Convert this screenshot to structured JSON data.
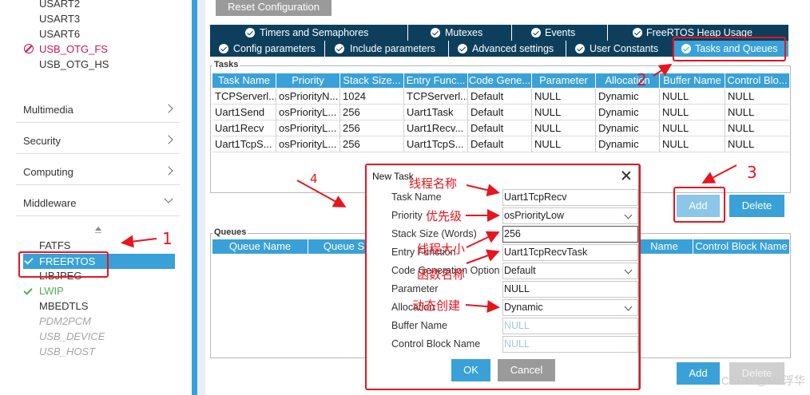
{
  "sidebar": {
    "peripherals": [
      {
        "label": "USART2",
        "status": "normal"
      },
      {
        "label": "USART3",
        "status": "normal"
      },
      {
        "label": "USART6",
        "status": "normal"
      },
      {
        "label": "USB_OTG_FS",
        "status": "error"
      },
      {
        "label": "USB_OTG_HS",
        "status": "normal"
      }
    ],
    "categories": [
      {
        "label": "Multimedia",
        "icon": "chevron-right-icon"
      },
      {
        "label": "Security",
        "icon": "chevron-right-icon"
      },
      {
        "label": "Computing",
        "icon": "chevron-right-icon"
      },
      {
        "label": "Middleware",
        "icon": "chevron-down-icon"
      }
    ],
    "middleware": [
      {
        "label": "FATFS",
        "status": "normal"
      },
      {
        "label": "FREERTOS",
        "status": "selected"
      },
      {
        "label": "LIBJPEG",
        "status": "normal"
      },
      {
        "label": "LWIP",
        "status": "enabled"
      },
      {
        "label": "MBEDTLS",
        "status": "normal"
      },
      {
        "label": "PDM2PCM",
        "status": "disabled"
      },
      {
        "label": "USB_DEVICE",
        "status": "disabled"
      },
      {
        "label": "USB_HOST",
        "status": "disabled"
      }
    ]
  },
  "main": {
    "reset_label": "Reset Configuration",
    "tabs_row1": [
      "Timers and Semaphores",
      "Mutexes",
      "Events",
      "FreeRTOS Heap Usage"
    ],
    "tabs_row2": [
      "Config parameters",
      "Include parameters",
      "Advanced settings",
      "User Constants",
      "Tasks and Queues"
    ],
    "active_tab": "Tasks and Queues",
    "tasks": {
      "title": "Tasks",
      "columns": [
        "Task Name",
        "Priority",
        "Stack Size...",
        "Entry Func...",
        "Code Gene...",
        "Parameter",
        "Allocation",
        "Buffer Name",
        "Control Blo..."
      ],
      "rows": [
        [
          "TCPServerl...",
          "osPriorityN...",
          "1024",
          "TCPServerl...",
          "Default",
          "NULL",
          "Dynamic",
          "NULL",
          "NULL"
        ],
        [
          "Uart1Send",
          "osPriorityL...",
          "256",
          "Uart1Task",
          "Default",
          "NULL",
          "Dynamic",
          "NULL",
          "NULL"
        ],
        [
          "Uart1Recv",
          "osPriorityL...",
          "256",
          "Uart1Recv...",
          "Default",
          "NULL",
          "Dynamic",
          "NULL",
          "NULL"
        ],
        [
          "Uart1TcpS...",
          "osPriorityL...",
          "256",
          "Uart1TcpS...",
          "Default",
          "NULL",
          "Dynamic",
          "NULL",
          "NULL"
        ]
      ],
      "add_label": "Add",
      "delete_label": "Delete"
    },
    "queues": {
      "title": "Queues",
      "columns_left": [
        "Queue Name",
        "Queue S"
      ],
      "columns_right": [
        "Name",
        "Control Block Name"
      ],
      "add_label": "Add",
      "delete_label": "Delete"
    }
  },
  "dialog": {
    "title": "New Task",
    "fields": [
      {
        "label": "Task Name",
        "value": "Uart1TcpRecv",
        "kind": "text"
      },
      {
        "label": "Priority",
        "value": "osPriorityLow",
        "kind": "select"
      },
      {
        "label": "Stack Size (Words)",
        "value": "256",
        "kind": "text-focus"
      },
      {
        "label": "Entry Function",
        "value": "Uart1TcpRecvTask",
        "kind": "text"
      },
      {
        "label": "Code Generation Option",
        "value": "Default",
        "kind": "select"
      },
      {
        "label": "Parameter",
        "value": "NULL",
        "kind": "text"
      },
      {
        "label": "Allocation",
        "value": "Dynamic",
        "kind": "select"
      },
      {
        "label": "Buffer Name",
        "value": "NULL",
        "kind": "text-empty"
      },
      {
        "label": "Control Block Name",
        "value": "NULL",
        "kind": "text-empty"
      }
    ],
    "ok_label": "OK",
    "cancel_label": "Cancel"
  },
  "annotations": {
    "task_name": "线程名称",
    "priority": "优先级",
    "stack_size": "线程大小",
    "entry_function": "函数名称",
    "allocation": "动态创建",
    "step1": "1",
    "step2": "2",
    "step3": "3",
    "step4": "4"
  },
  "watermark": "CSDN @Mr.浮华",
  "colors": {
    "accent": "#39a1d8",
    "tab_dark": "#0d3f5d",
    "error": "#c2185b",
    "ok": "#4caf50",
    "annotation_red": "#e8141e"
  }
}
